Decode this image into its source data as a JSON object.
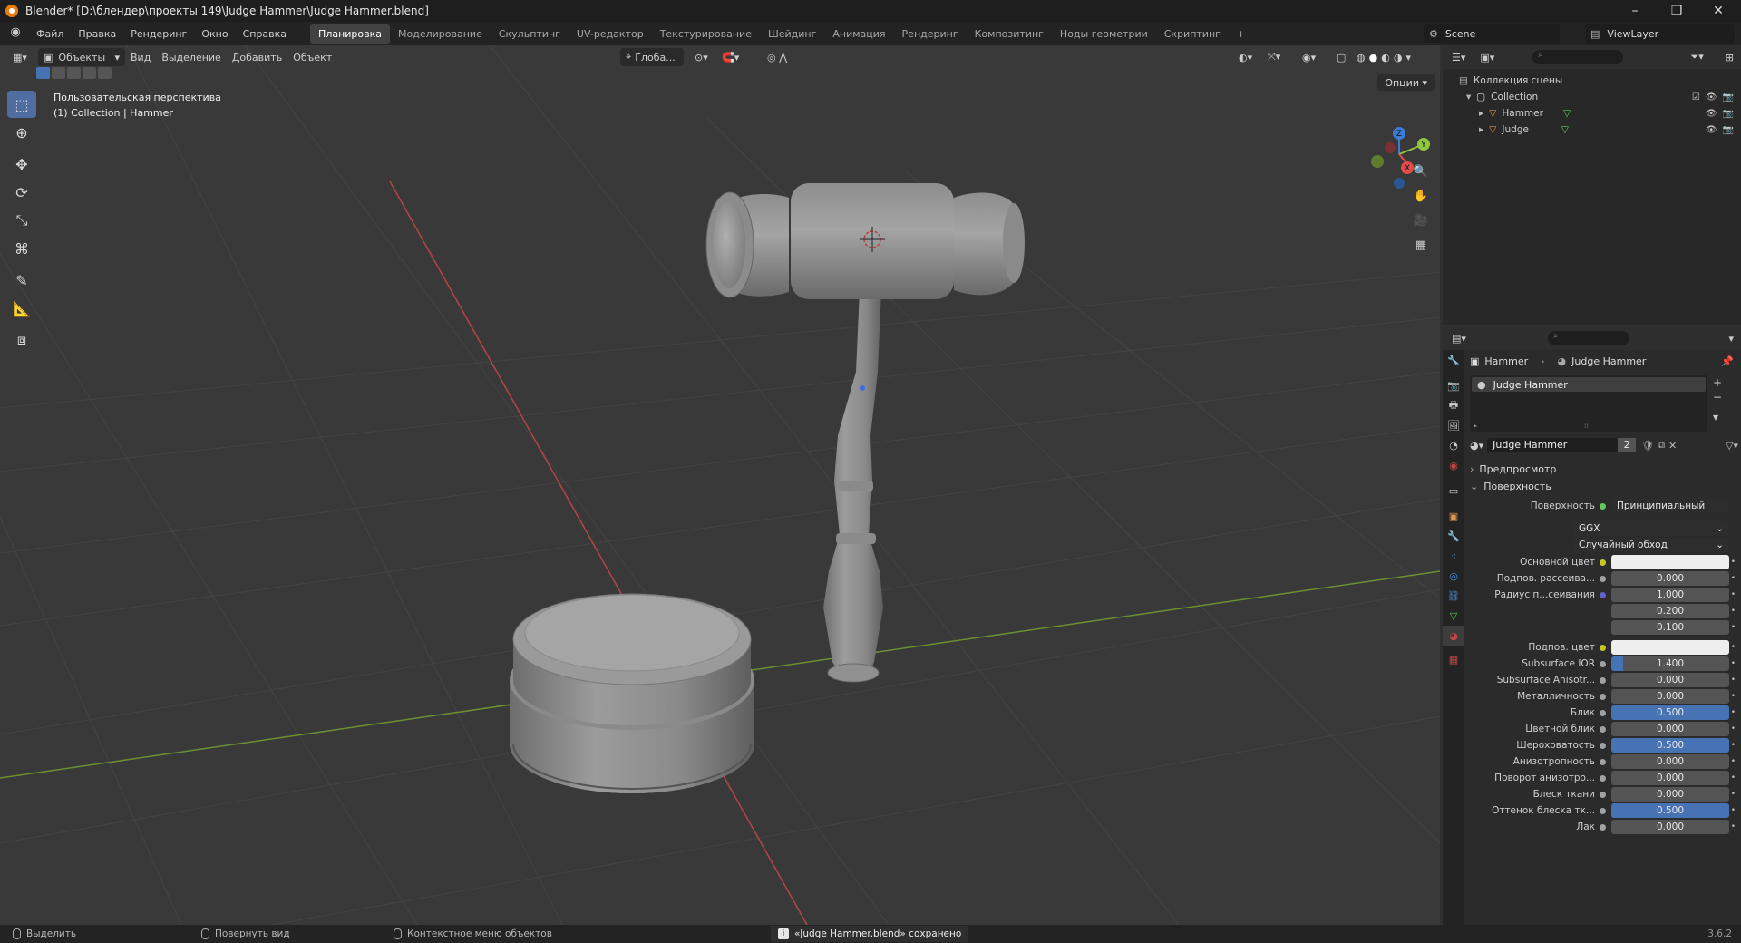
{
  "window": {
    "title": "Blender* [D:\\блендер\\проекты 149\\Judge Hammer\\Judge Hammer.blend]",
    "controls": [
      "–",
      "❐",
      "✕"
    ]
  },
  "menu": {
    "items": [
      "Файл",
      "Правка",
      "Рендеринг",
      "Окно",
      "Справка"
    ],
    "workspaces": [
      "Планировка",
      "Моделирование",
      "Скульптинг",
      "UV-редактор",
      "Текстурирование",
      "Шейдинг",
      "Анимация",
      "Рендеринг",
      "Композитинг",
      "Ноды геометрии",
      "Скриптинг"
    ],
    "active_workspace": "Планировка",
    "add_tab": "+",
    "scene": "Scene",
    "view_layer": "ViewLayer"
  },
  "viewport": {
    "mode": "Объекты",
    "menus": [
      "Вид",
      "Выделение",
      "Добавить",
      "Объект"
    ],
    "orientation": "Глоба...",
    "view_name": "Пользовательская перспектива",
    "collection_info": "(1) Collection | Hammer",
    "options": "Опции",
    "gizmo": {
      "x": "X",
      "y": "Y",
      "z": "Z"
    }
  },
  "outliner": {
    "scene_collection": "Коллекция сцены",
    "collection": "Collection",
    "objects": [
      "Hammer",
      "Judge"
    ]
  },
  "properties": {
    "breadcrumb": {
      "object": "Hammer",
      "material": "Judge Hammer"
    },
    "slot": "Judge Hammer",
    "material_name": "Judge Hammer",
    "users": "2",
    "panels": {
      "preview": "Предпросмотр",
      "surface": "Поверхность"
    },
    "surface_label": "Поверхность",
    "surface_value": "Принципиальный BSDF",
    "distribution": "GGX",
    "subsurface_method": "Случайный обход",
    "rows": [
      {
        "label": "Основной цвет",
        "type": "color",
        "socket": "yellow"
      },
      {
        "label": "Подпов. рассеива...",
        "value": "0.000",
        "socket": "grey",
        "fill": 0
      },
      {
        "label": "Радиус п...сеивания",
        "value": "1.000",
        "socket": "blue",
        "fill": 0
      },
      {
        "label": "",
        "value": "0.200",
        "socket": "none",
        "fill": 0
      },
      {
        "label": "",
        "value": "0.100",
        "socket": "none",
        "fill": 0
      },
      {
        "label": "Подпов. цвет",
        "type": "color",
        "socket": "yellow"
      },
      {
        "label": "Subsurface IOR",
        "value": "1.400",
        "socket": "grey",
        "fill": 0.1
      },
      {
        "label": "Subsurface Anisotr...",
        "value": "0.000",
        "socket": "grey",
        "fill": 0
      },
      {
        "label": "Металличность",
        "value": "0.000",
        "socket": "grey",
        "fill": 0
      },
      {
        "label": "Блик",
        "value": "0.500",
        "socket": "grey",
        "fill": 1
      },
      {
        "label": "Цветной блик",
        "value": "0.000",
        "socket": "grey",
        "fill": 0
      },
      {
        "label": "Шероховатость",
        "value": "0.500",
        "socket": "grey",
        "fill": 1
      },
      {
        "label": "Анизотропность",
        "value": "0.000",
        "socket": "grey",
        "fill": 0
      },
      {
        "label": "Поворот анизотро...",
        "value": "0.000",
        "socket": "grey",
        "fill": 0
      },
      {
        "label": "Блеск ткани",
        "value": "0.000",
        "socket": "grey",
        "fill": 0
      },
      {
        "label": "Оттенок блеска тк...",
        "value": "0.500",
        "socket": "grey",
        "fill": 1
      },
      {
        "label": "Лак",
        "value": "0.000",
        "socket": "grey",
        "fill": 0
      }
    ]
  },
  "status": {
    "select": "Выделить",
    "rotate": "Повернуть вид",
    "context": "Контекстное меню объектов",
    "saved": "«Judge Hammer.blend» сохранено",
    "version": "3.6.2"
  },
  "colors": {
    "accent": "#4772b3",
    "viewport_bg": "#393939",
    "x_axis": "#e44b4b",
    "y_axis": "#8ec63f",
    "z_axis": "#3c7cd6"
  }
}
